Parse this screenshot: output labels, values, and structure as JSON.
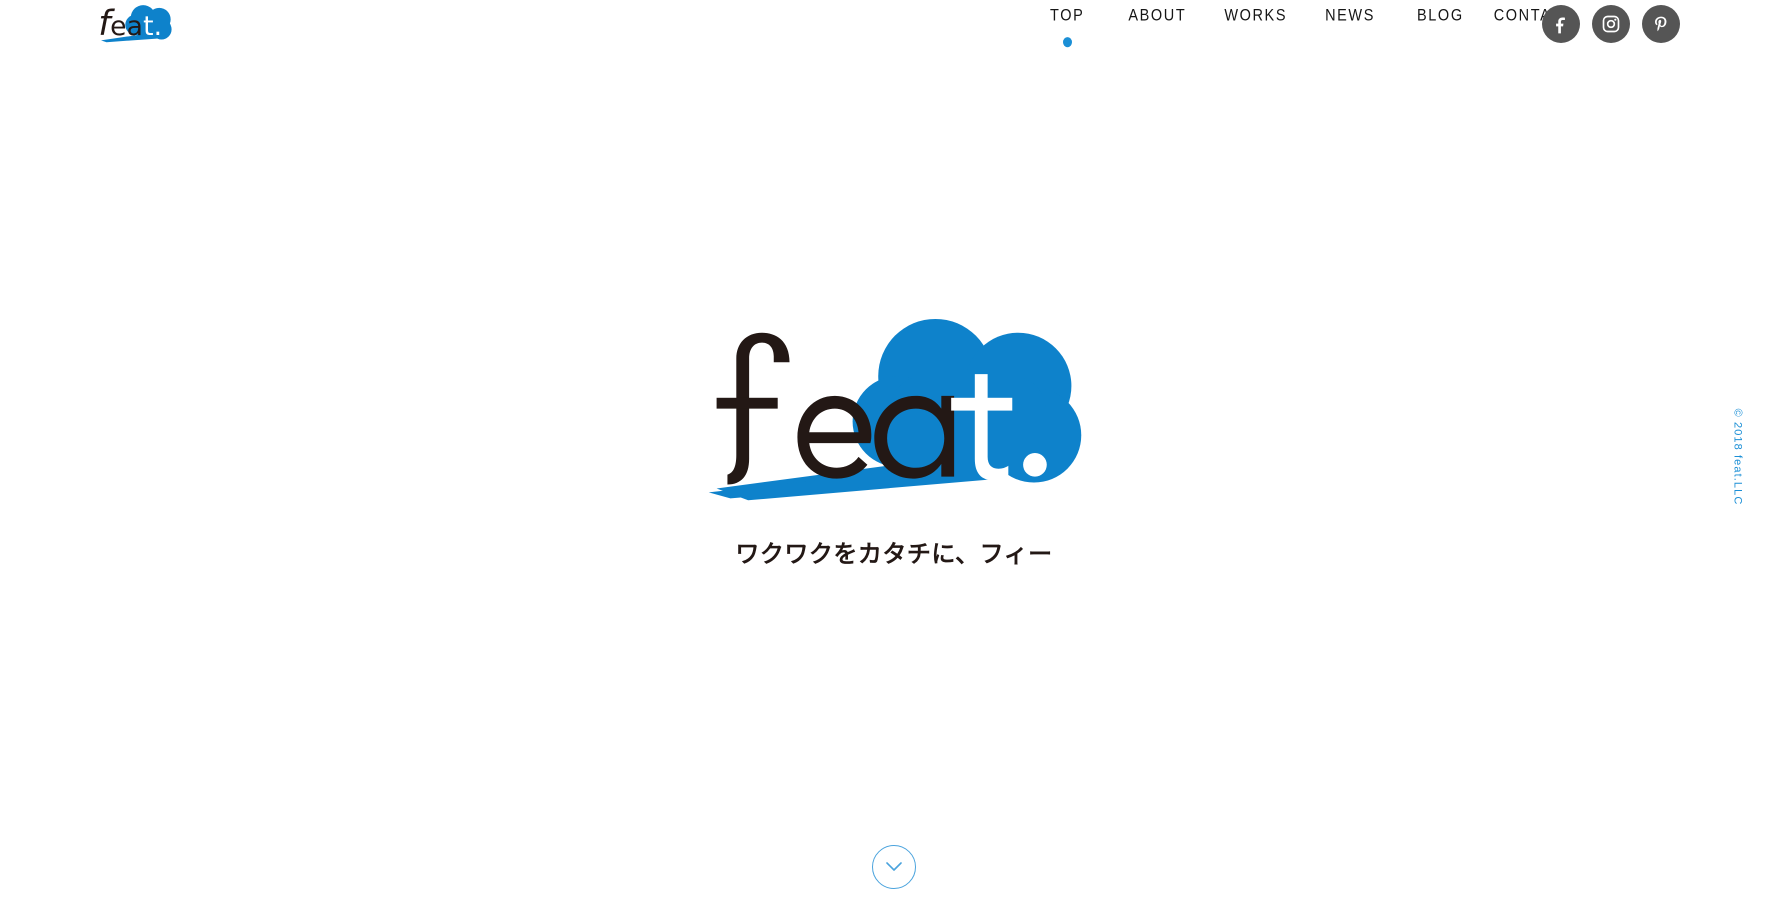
{
  "site": {
    "brand_name": "feat.",
    "brand_logo_icon": "feat-cloud-logo-icon"
  },
  "nav": {
    "items": [
      {
        "label": "TOP",
        "active": true
      },
      {
        "label": "ABOUT",
        "active": false
      },
      {
        "label": "WORKS",
        "active": false
      },
      {
        "label": "NEWS",
        "active": false
      },
      {
        "label": "BLOG",
        "active": false
      },
      {
        "label": "CONTACT",
        "active": false
      }
    ]
  },
  "social": {
    "items": [
      {
        "name": "facebook",
        "icon": "facebook-icon"
      },
      {
        "name": "instagram",
        "icon": "instagram-icon"
      },
      {
        "name": "pinterest",
        "icon": "pinterest-icon"
      }
    ]
  },
  "hero": {
    "logo_icon": "feat-cloud-logo-icon",
    "logo_text": "feat.",
    "tagline": "ワクワクをカタチに、フィー"
  },
  "footer": {
    "copyright": "© 2018 feat.LLC"
  },
  "scroll": {
    "icon": "chevron-down-icon"
  },
  "colors": {
    "brand_blue": "#0e82cb",
    "accent_blue": "#1b8fd6",
    "outline_blue": "#4aa3dd",
    "ink": "#231815",
    "social_gray": "#555555",
    "background": "#ffffff"
  }
}
